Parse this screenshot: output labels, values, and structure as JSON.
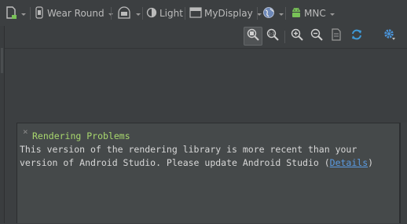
{
  "toolbar": {
    "device": "Wear Round",
    "theme": "Light",
    "activity": "MyDisplay",
    "api": "MNC"
  },
  "panel": {
    "title": "Rendering Problems",
    "message_line1": "This version of the rendering library is more recent than your",
    "message_line2_before": "version of Android Studio. Please update Android Studio (",
    "link": "Details",
    "message_line2_after": ")"
  },
  "colors": {
    "background": "#3c3f41",
    "panel": "#45494a",
    "title_green": "#a9d86e",
    "link_blue": "#5a9be2",
    "android_green": "#78c257"
  },
  "icons": [
    "document-icon",
    "watch-icon",
    "orientation-icon",
    "theme-icon",
    "activity-icon",
    "globe-icon",
    "android-icon",
    "zoom-actual-icon",
    "zoom-fit-icon",
    "zoom-in-icon",
    "zoom-out-icon",
    "page-icon",
    "refresh-icon",
    "settings-icon",
    "close-icon"
  ]
}
